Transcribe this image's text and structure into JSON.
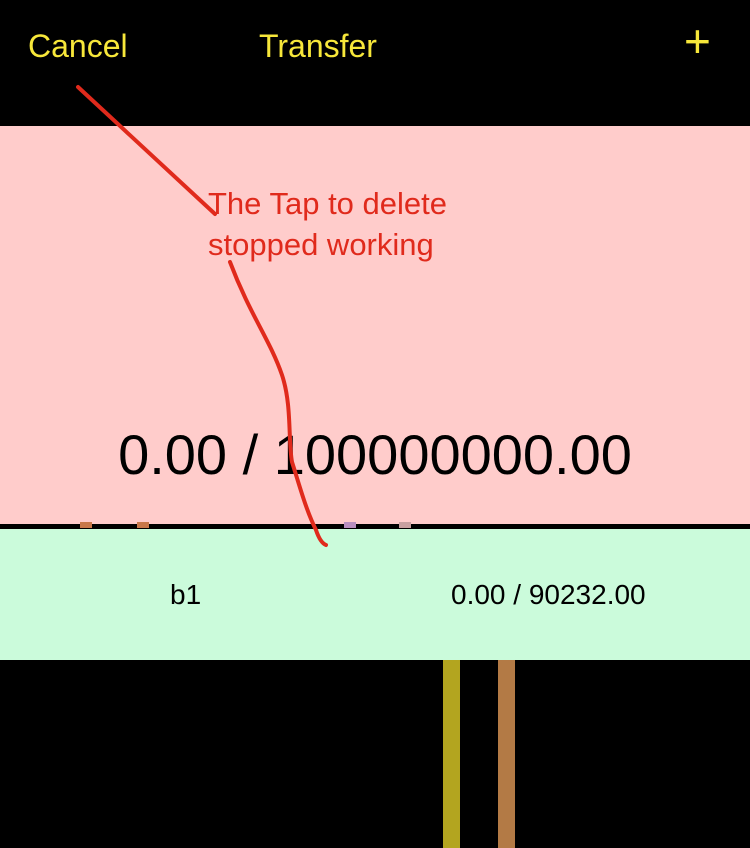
{
  "navbar": {
    "cancel_label": "Cancel",
    "title": "Transfer",
    "add_label": "+"
  },
  "total": {
    "amount": "0.00 / 100000000.00"
  },
  "rows": [
    {
      "name": "b1",
      "amount": "0.00 / 90232.00"
    }
  ],
  "annotation": {
    "line1": "The Tap to delete",
    "line2": "stopped working"
  },
  "colors": {
    "accent": "#f7e73a",
    "total_bg": "#ffcccb",
    "row_bg": "#cbfbdb",
    "annotation": "#e02a1c"
  }
}
